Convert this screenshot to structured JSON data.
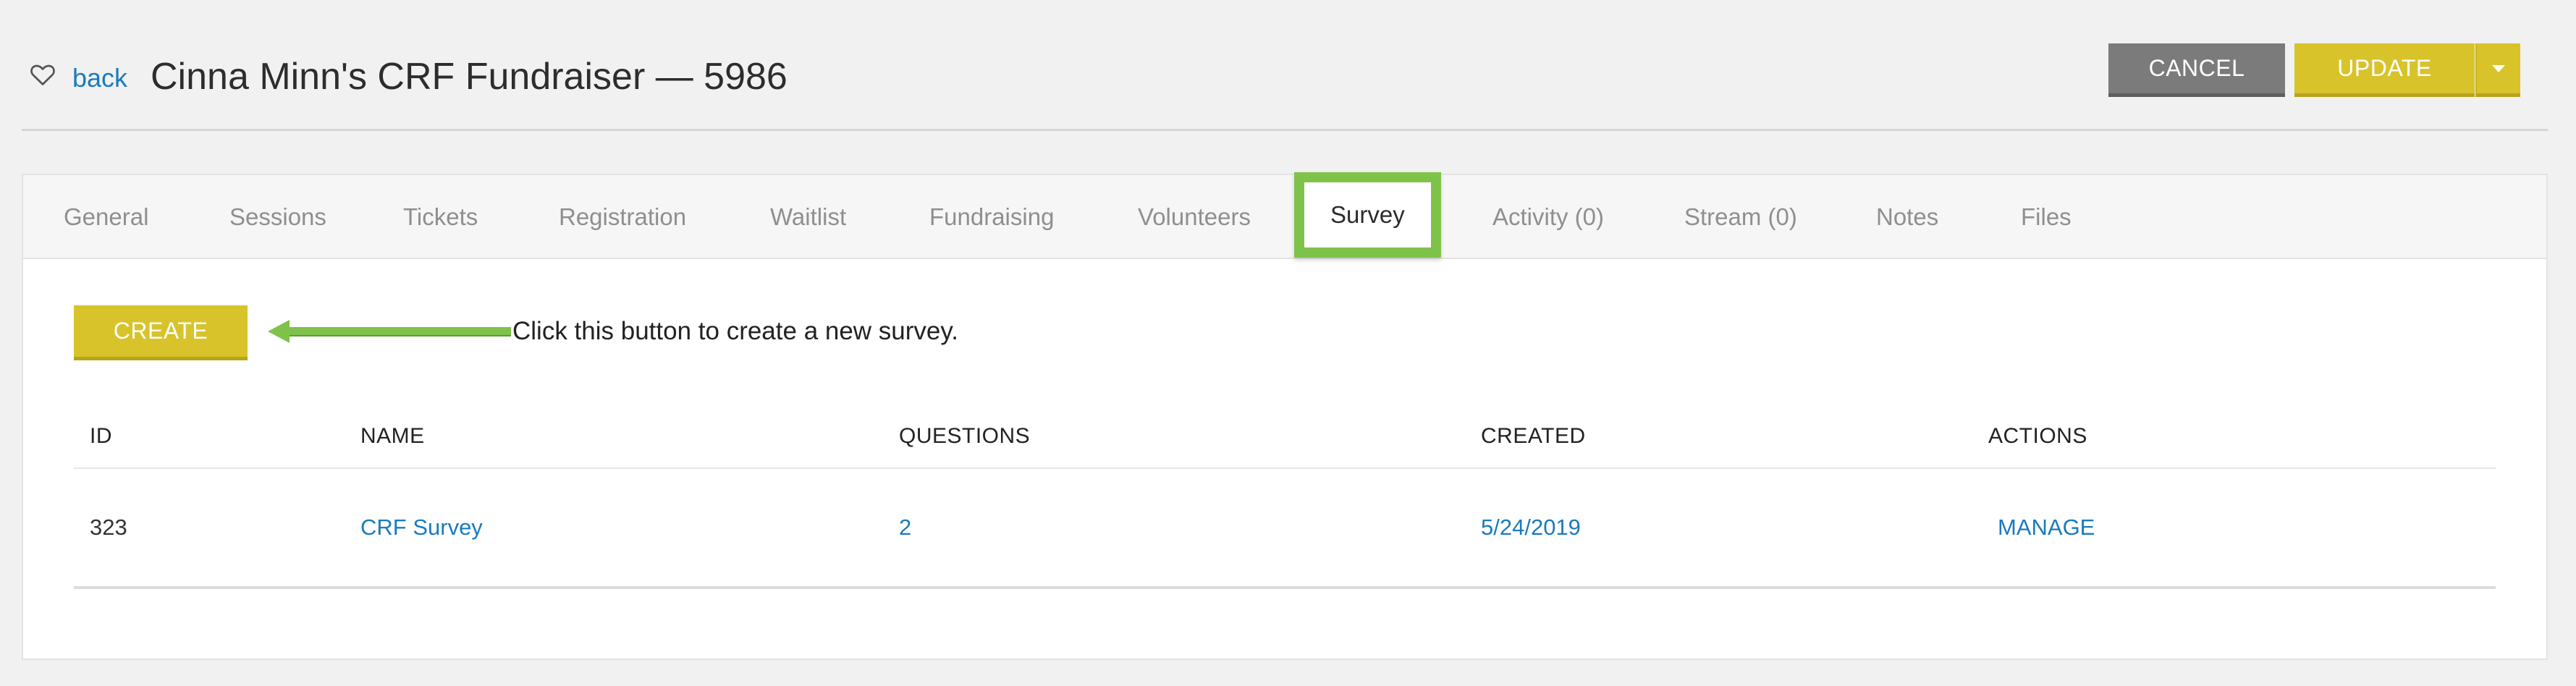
{
  "header": {
    "back_label": "back",
    "title": "Cinna Minn's CRF Fundraiser — 5986",
    "cancel_label": "CANCEL",
    "update_label": "UPDATE",
    "favorite_icon": "heart-outline-icon",
    "dropdown_icon": "caret-down-icon"
  },
  "tabs": [
    {
      "label": "General"
    },
    {
      "label": "Sessions"
    },
    {
      "label": "Tickets"
    },
    {
      "label": "Registration"
    },
    {
      "label": "Waitlist"
    },
    {
      "label": "Fundraising"
    },
    {
      "label": "Volunteers"
    },
    {
      "label": "Survey",
      "active": true
    },
    {
      "label": "Activity (0)"
    },
    {
      "label": "Stream (0)"
    },
    {
      "label": "Notes"
    },
    {
      "label": "Files"
    }
  ],
  "survey": {
    "create_label": "CREATE",
    "hint_text": "Click this button to create a new survey.",
    "columns": [
      "ID",
      "NAME",
      "QUESTIONS",
      "CREATED",
      "ACTIONS"
    ],
    "rows": [
      {
        "id": "323",
        "name": "CRF Survey",
        "questions": "2",
        "created": "5/24/2019",
        "action": "MANAGE"
      }
    ]
  },
  "colors": {
    "accent_yellow": "#d8c32b",
    "cancel_gray": "#7b7b7b",
    "link_blue": "#1a7bbd",
    "highlight_green": "#7fc24a"
  }
}
